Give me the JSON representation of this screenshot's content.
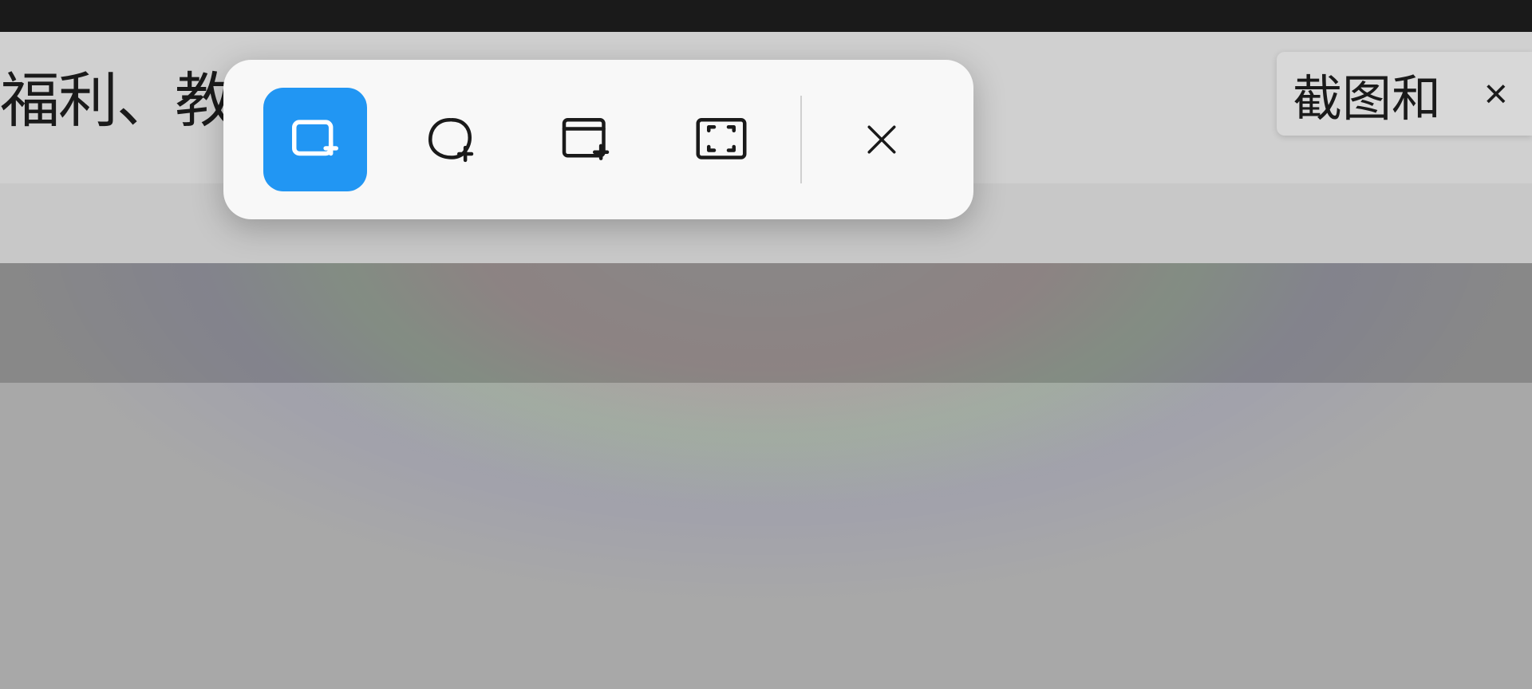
{
  "background_text_left": "福利、教程",
  "notification": {
    "text": "截图和",
    "close_label": "×"
  },
  "toolbar": {
    "tools": [
      {
        "name": "rectangle-snip",
        "active": true
      },
      {
        "name": "freeform-snip",
        "active": false
      },
      {
        "name": "window-snip",
        "active": false
      },
      {
        "name": "fullscreen-snip",
        "active": false
      }
    ],
    "close_label": "×"
  }
}
